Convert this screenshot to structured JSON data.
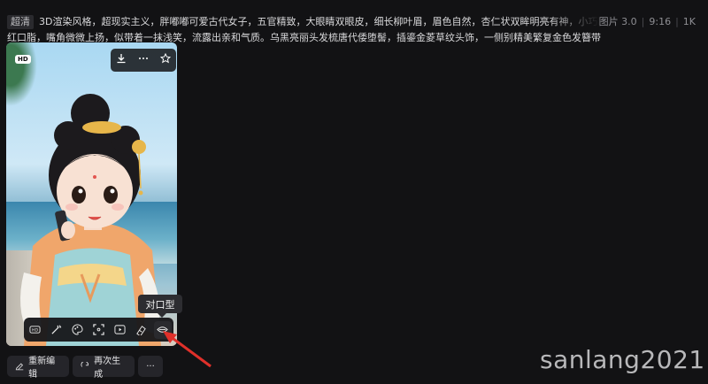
{
  "prompt": {
    "quality_badge": "超清",
    "line1": "3D渲染风格，超现实主义，胖嘟嘟可爱古代女子，五官精致，大眼睛双眼皮，细长柳叶眉，眉色自然，杏仁状双眸明亮有神，小巧精致鼻梁，饱满唇形涂鲜",
    "line2": "红口脂，嘴角微微上扬，似带着一抹浅笑，流露出亲和气质。乌黑亮丽头发梳唐代倭堕髻，插鎏金菱草纹头饰，一侧别精美繁复金色发簪带"
  },
  "meta": {
    "type": "图片 3.0",
    "ratio": "9:16",
    "resolution": "1K"
  },
  "image_card": {
    "hd_badge": "HD",
    "actions": [
      "download-icon",
      "more-icon",
      "star-icon"
    ]
  },
  "toolbar": {
    "tools": [
      "hd-icon",
      "magic-wand-icon",
      "palette-icon",
      "crop-icon",
      "play-icon",
      "eraser-icon",
      "lip-sync-icon"
    ],
    "tooltip": "对口型"
  },
  "buttons": {
    "reedit": "重新编辑",
    "regenerate": "再次生成",
    "more": "···"
  },
  "watermark": "sanlang2021",
  "colors": {
    "background": "#121214",
    "annotation_arrow": "#e0302a"
  }
}
